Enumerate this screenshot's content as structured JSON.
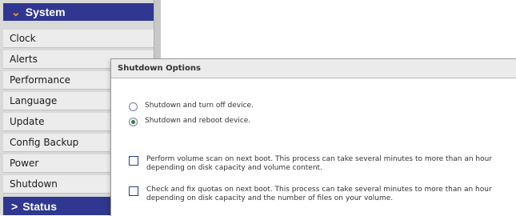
{
  "sidebar": {
    "system_header": "System",
    "system_icon": "chevron-down-icon",
    "items": [
      {
        "label": "Clock"
      },
      {
        "label": "Alerts"
      },
      {
        "label": "Performance"
      },
      {
        "label": "Language"
      },
      {
        "label": "Update"
      },
      {
        "label": "Config Backup"
      },
      {
        "label": "Power"
      },
      {
        "label": "Shutdown"
      }
    ],
    "status_header": "Status",
    "status_icon": "chevron-right-icon",
    "header_color": "#2f3790",
    "accent_color": "#f59a23"
  },
  "panel": {
    "title": "Shutdown Options",
    "radio_options": [
      {
        "label": "Shutdown and turn off device.",
        "selected": false
      },
      {
        "label": "Shutdown and reboot device.",
        "selected": true
      }
    ],
    "checkbox_options": [
      {
        "label": "Perform volume scan on next boot. This process can take several minutes to more than an hour depending on disk capacity and volume content.",
        "checked": false
      },
      {
        "label": "Check and fix quotas on next boot. This process can take several minutes to more than an hour depending on disk capacity and the number of files on your volume.",
        "checked": false
      }
    ]
  }
}
